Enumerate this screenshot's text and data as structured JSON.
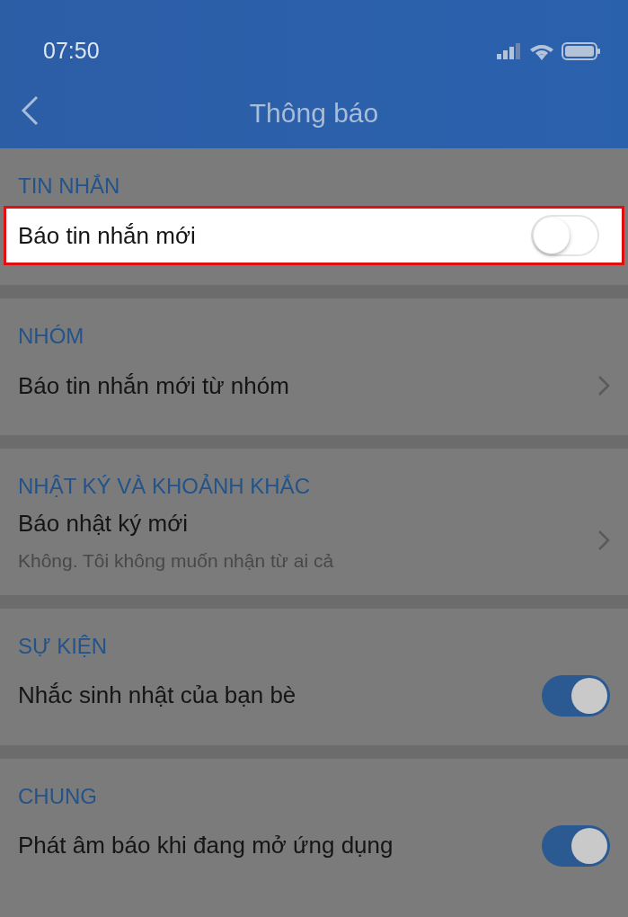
{
  "status_bar": {
    "time": "07:50"
  },
  "header": {
    "title": "Thông báo"
  },
  "sections": [
    {
      "title": "TIN NHẮN",
      "items": [
        {
          "kind": "toggle",
          "label": "Báo tin nhắn mới",
          "on": false,
          "highlighted": true
        }
      ]
    },
    {
      "title": "NHÓM",
      "items": [
        {
          "kind": "link",
          "label": "Báo tin nhắn mới từ nhóm",
          "highlighted": false
        }
      ]
    },
    {
      "title": "NHẬT KÝ VÀ KHOẢNH KHẮC",
      "items": [
        {
          "kind": "link",
          "label": "Báo nhật ký mới",
          "subtitle": "Không. Tôi không muốn nhận từ ai cả",
          "highlighted": false
        }
      ]
    },
    {
      "title": "SỰ KIỆN",
      "items": [
        {
          "kind": "toggle",
          "label": "Nhắc sinh nhật của bạn bè",
          "on": true,
          "highlighted": false
        }
      ]
    },
    {
      "title": "CHUNG",
      "items": [
        {
          "kind": "toggle",
          "label": "Phát âm báo khi đang mở ứng dụng",
          "on": true,
          "highlighted": false
        }
      ]
    }
  ]
}
